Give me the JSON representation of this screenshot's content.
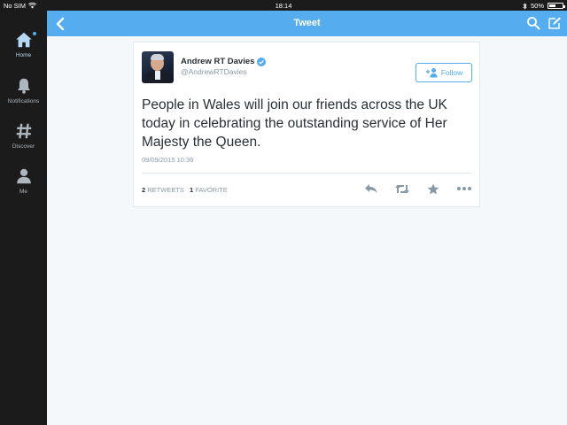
{
  "status_bar": {
    "carrier": "No SIM",
    "time": "18:14",
    "battery": "50%",
    "battery_level": 0.5
  },
  "sidebar": {
    "items": [
      {
        "label": "Home",
        "icon": "home-icon",
        "active": true
      },
      {
        "label": "Notifications",
        "icon": "bell-icon",
        "active": false
      },
      {
        "label": "Discover",
        "icon": "hashtag-icon",
        "active": false
      },
      {
        "label": "Me",
        "icon": "person-icon",
        "active": false
      }
    ]
  },
  "header": {
    "title": "Tweet",
    "back_icon": "chevron-left-icon",
    "search_icon": "search-icon",
    "compose_icon": "compose-icon"
  },
  "tweet": {
    "author_name": "Andrew RT Davies",
    "handle": "@AndrewRTDavies",
    "verified": true,
    "follow_label": "Follow",
    "text": "People in Wales will join our friends across the UK today in celebrating the outstanding service of Her Majesty the Queen.",
    "timestamp": "09/09/2015 10:36",
    "retweets_count": "2",
    "retweets_label": "RETWEETS",
    "favorites_count": "1",
    "favorites_label": "FAVORITE",
    "actions": [
      "reply-icon",
      "retweet-icon",
      "favorite-star-icon",
      "more-icon"
    ]
  },
  "colors": {
    "brand_blue": "#55acee",
    "sidebar_bg": "#1b1b1b",
    "text": "#292f33",
    "muted": "#8899a6"
  }
}
